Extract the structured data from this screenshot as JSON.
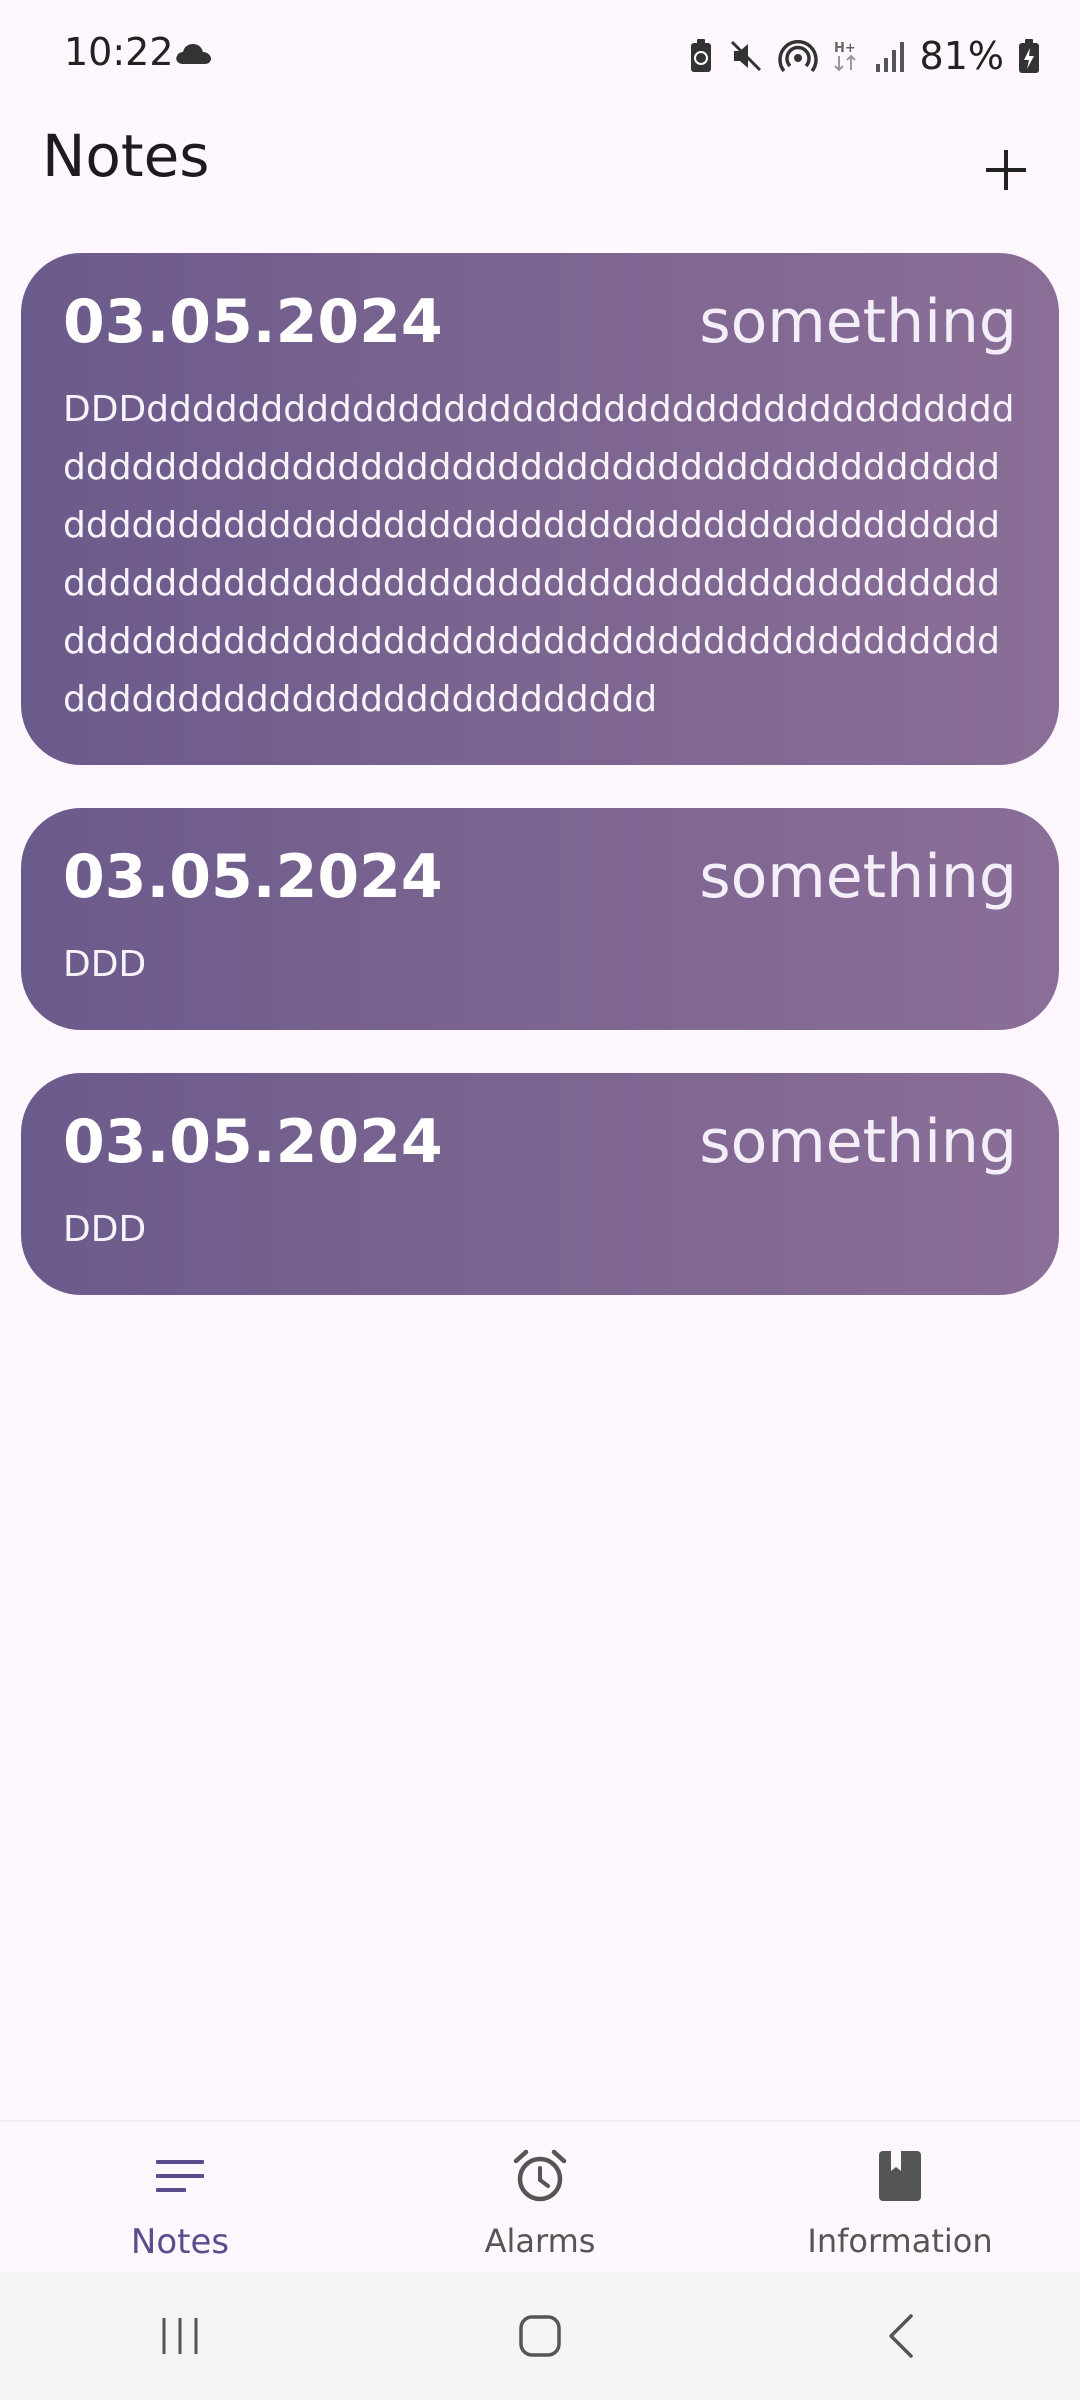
{
  "status_bar": {
    "time": "10:22",
    "battery": "81%",
    "icons": [
      "cloud-icon",
      "battery-saver-icon",
      "mute-icon",
      "hotspot-icon",
      "network-hplus-icon",
      "signal-icon",
      "battery-charging-icon"
    ]
  },
  "app_bar": {
    "title": "Notes",
    "add_icon": "plus-icon"
  },
  "notes": [
    {
      "date": "03.05.2024",
      "tag": "something",
      "body": "DDDdddddddddddddddddddddddddddddddddddddddddddddddddddddddddddddddddddddddddddddddddddddddddddddddddddddddddddddddddddddddddddddddddddddddddddddddddddddddddddddddddddddddddddddddddddddddddddddddddddddddddddddddddddddddddddddddddddd"
    },
    {
      "date": "03.05.2024",
      "tag": "something",
      "body": "DDD"
    },
    {
      "date": "03.05.2024",
      "tag": "something",
      "body": "DDD"
    }
  ],
  "bottom_nav": {
    "items": [
      {
        "label": "Notes",
        "icon": "notes-icon",
        "active": true
      },
      {
        "label": "Alarms",
        "icon": "alarm-icon",
        "active": false
      },
      {
        "label": "Information",
        "icon": "book-icon",
        "active": false
      }
    ]
  },
  "system_nav": {
    "icons": [
      "recent-apps-icon",
      "home-icon",
      "back-icon"
    ]
  },
  "colors": {
    "background": "#FEF7FE",
    "card_gradient_start": "#6B5A8C",
    "card_gradient_end": "#8A6E98",
    "active_nav": "#5C4C8E"
  }
}
